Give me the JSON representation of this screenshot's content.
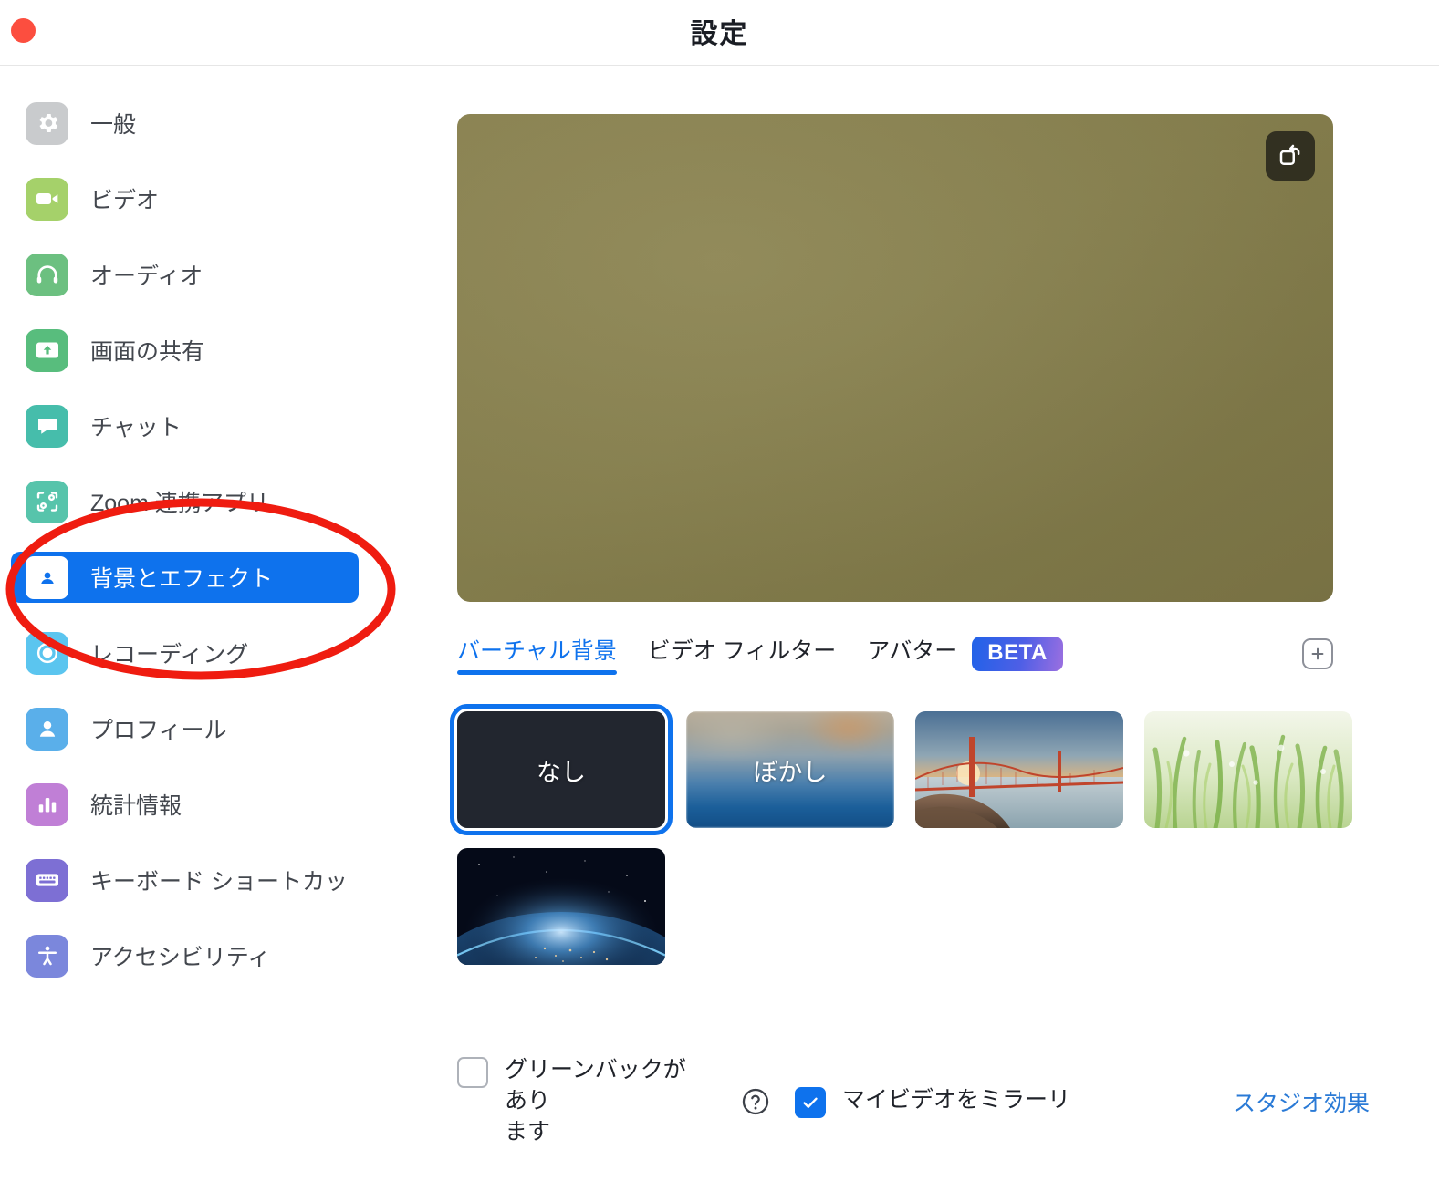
{
  "window": {
    "title": "設定",
    "close_button": "close"
  },
  "sidebar": {
    "items": [
      {
        "label": "一般",
        "icon": "gear-icon",
        "color": "#c9cbcd",
        "active": false
      },
      {
        "label": "ビデオ",
        "icon": "video-camera-icon",
        "color": "#a5d16a",
        "active": false
      },
      {
        "label": "オーディオ",
        "icon": "headphones-icon",
        "color": "#6cc080",
        "active": false
      },
      {
        "label": "画面の共有",
        "icon": "share-screen-icon",
        "color": "#58bd7d",
        "active": false
      },
      {
        "label": "チャット",
        "icon": "chat-bubble-icon",
        "color": "#46bdab",
        "active": false
      },
      {
        "label": "Zoom 連携アプリ",
        "icon": "zoom-apps-icon",
        "color": "#57c4ab",
        "active": false
      },
      {
        "label": "背景とエフェクト",
        "icon": "person-frame-icon",
        "color": "#0E72ED",
        "active": true
      },
      {
        "label": "レコーディング",
        "icon": "record-icon",
        "color": "#5bc5ef",
        "active": false
      },
      {
        "label": "プロフィール",
        "icon": "profile-icon",
        "color": "#5aafea",
        "active": false
      },
      {
        "label": "統計情報",
        "icon": "bar-chart-icon",
        "color": "#c07fd6",
        "active": false
      },
      {
        "label": "キーボード ショートカッ",
        "icon": "keyboard-icon",
        "color": "#7d6fd4",
        "active": false
      },
      {
        "label": "アクセシビリティ",
        "icon": "accessibility-icon",
        "color": "#7b87dc",
        "active": false
      }
    ]
  },
  "annotation": {
    "type": "red-ellipse-highlight",
    "color": "#ef1c10",
    "targets": "背景とエフェクト"
  },
  "preview": {
    "rotate_button_icon": "rotate-camera-icon",
    "video_color": "#8a8350"
  },
  "tabs": [
    {
      "label": "バーチャル背景",
      "active": true
    },
    {
      "label": "ビデオ フィルター",
      "active": false
    },
    {
      "label": "アバター",
      "active": false
    }
  ],
  "beta_badge": "BETA",
  "add_button_icon": "plus-icon",
  "backgrounds": [
    {
      "label": "なし",
      "kind": "none",
      "selected": true
    },
    {
      "label": "ぼかし",
      "kind": "blur",
      "selected": false
    },
    {
      "label": "",
      "kind": "golden-gate-bridge",
      "selected": false
    },
    {
      "label": "",
      "kind": "grass",
      "selected": false
    },
    {
      "label": "",
      "kind": "earth-from-space",
      "selected": false
    }
  ],
  "options": {
    "green_screen": {
      "label": "グリーンバックがあり\nます",
      "checked": false
    },
    "help_icon": "question-mark-icon",
    "mirror_video": {
      "label": "マイビデオをミラーリ",
      "checked": true
    },
    "studio_effects_link": "スタジオ効果"
  },
  "colors": {
    "accent_blue": "#0E72ED",
    "link_blue": "#2a7ad6",
    "annotation_red": "#ef1c10"
  }
}
